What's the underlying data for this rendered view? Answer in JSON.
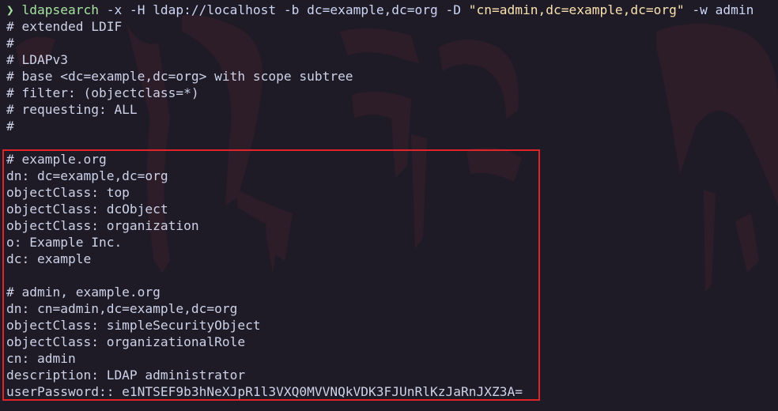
{
  "terminal": {
    "prompt_symbol": "❯",
    "command": {
      "program": "ldapsearch",
      "args_before_string": " -x -H ldap://localhost -b dc=example,dc=org -D ",
      "quoted_arg": "\"cn=admin,dc=example,dc=org\"",
      "args_after_string": " -w admin"
    },
    "output_lines": [
      "# extended LDIF",
      "#",
      "# LDAPv3",
      "# base <dc=example,dc=org> with scope subtree",
      "# filter: (objectclass=*)",
      "# requesting: ALL",
      "#",
      "",
      "# example.org",
      "dn: dc=example,dc=org",
      "objectClass: top",
      "objectClass: dcObject",
      "objectClass: organization",
      "o: Example Inc.",
      "dc: example",
      "",
      "# admin, example.org",
      "dn: cn=admin,dc=example,dc=org",
      "objectClass: simpleSecurityObject",
      "objectClass: organizationalRole",
      "cn: admin",
      "description: LDAP administrator",
      "userPassword:: e1NTSEF9b3hNeXJpR1l3VXQ0MVVNQkVDK3FJUnRlKzJaRnJXZ3A="
    ]
  },
  "colors": {
    "background": "#1e1b26",
    "text": "#cdd2e8",
    "prompt": "#a6e3a1",
    "string": "#f9e2af",
    "highlight_border": "#e0242a"
  }
}
